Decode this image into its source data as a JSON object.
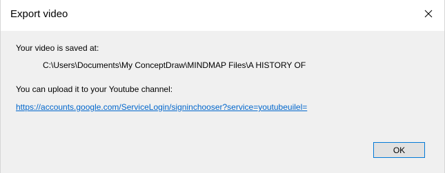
{
  "window": {
    "title": "Export video",
    "close_icon": "close-icon"
  },
  "message": {
    "saved_label": "Your video is saved at:",
    "saved_path": "C:\\Users\\Documents\\My ConceptDraw\\MINDMAP Files\\A HISTORY OF",
    "upload_label": "You can upload it to your Youtube channel:",
    "upload_link": "https://accounts.google.com/ServiceLogin/signinchooser?service=youtubeuilel="
  },
  "buttons": {
    "ok_label": "OK"
  },
  "colors": {
    "link": "#0066cc",
    "ok_border": "#0078d7"
  }
}
